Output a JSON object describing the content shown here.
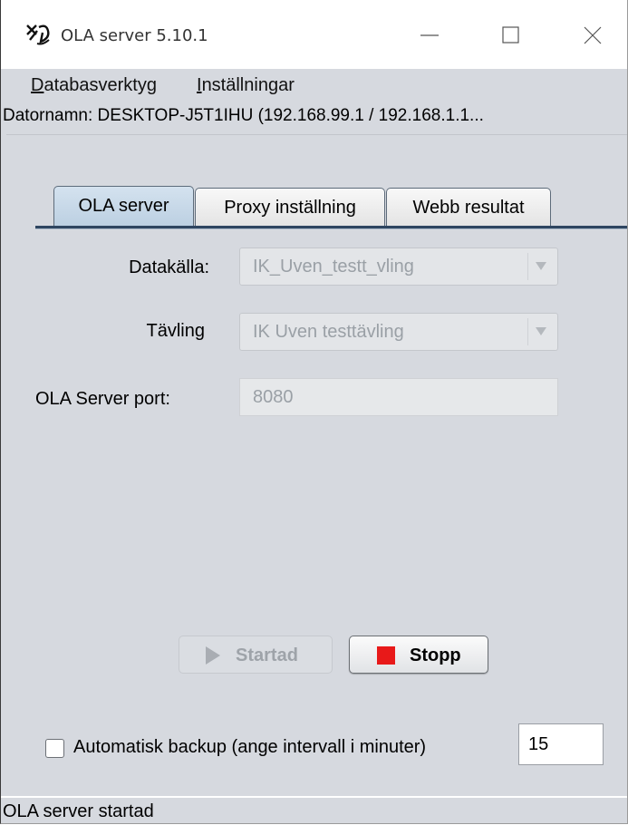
{
  "window": {
    "title": "OLA server 5.10.1"
  },
  "menu": {
    "databasverktyg_first": "D",
    "databasverktyg_rest": "atabasverktyg",
    "installningar_first": "I",
    "installningar_rest": "nställningar"
  },
  "computer_name": "Datornamn: DESKTOP-J5T1IHU (192.168.99.1 / 192.168.1.1...",
  "tabs": [
    {
      "label": "OLA server",
      "active": true
    },
    {
      "label": "Proxy inställning",
      "active": false
    },
    {
      "label": "Webb resultat",
      "active": false
    }
  ],
  "form": {
    "datakalla_label": "Datakälla:",
    "datakalla_value": "IK_Uven_testt_vling",
    "tavling_label": "Tävling",
    "tavling_value": "IK Uven testtävling",
    "port_label": "OLA Server port:",
    "port_value": "8080"
  },
  "buttons": {
    "started_label": "Startad",
    "stop_label": "Stopp"
  },
  "backup": {
    "label": "Automatisk backup (ange intervall i minuter)",
    "checked": false,
    "interval_value": "15"
  },
  "status": "OLA server startad",
  "colors": {
    "stop_red": "#e81919",
    "tab_active": "#c8d9ea",
    "background": "#d6d9df"
  },
  "icons": [
    "app-icon",
    "minimize-icon",
    "maximize-icon",
    "close-icon",
    "dropdown-arrow-icon",
    "play-icon",
    "stop-icon"
  ]
}
